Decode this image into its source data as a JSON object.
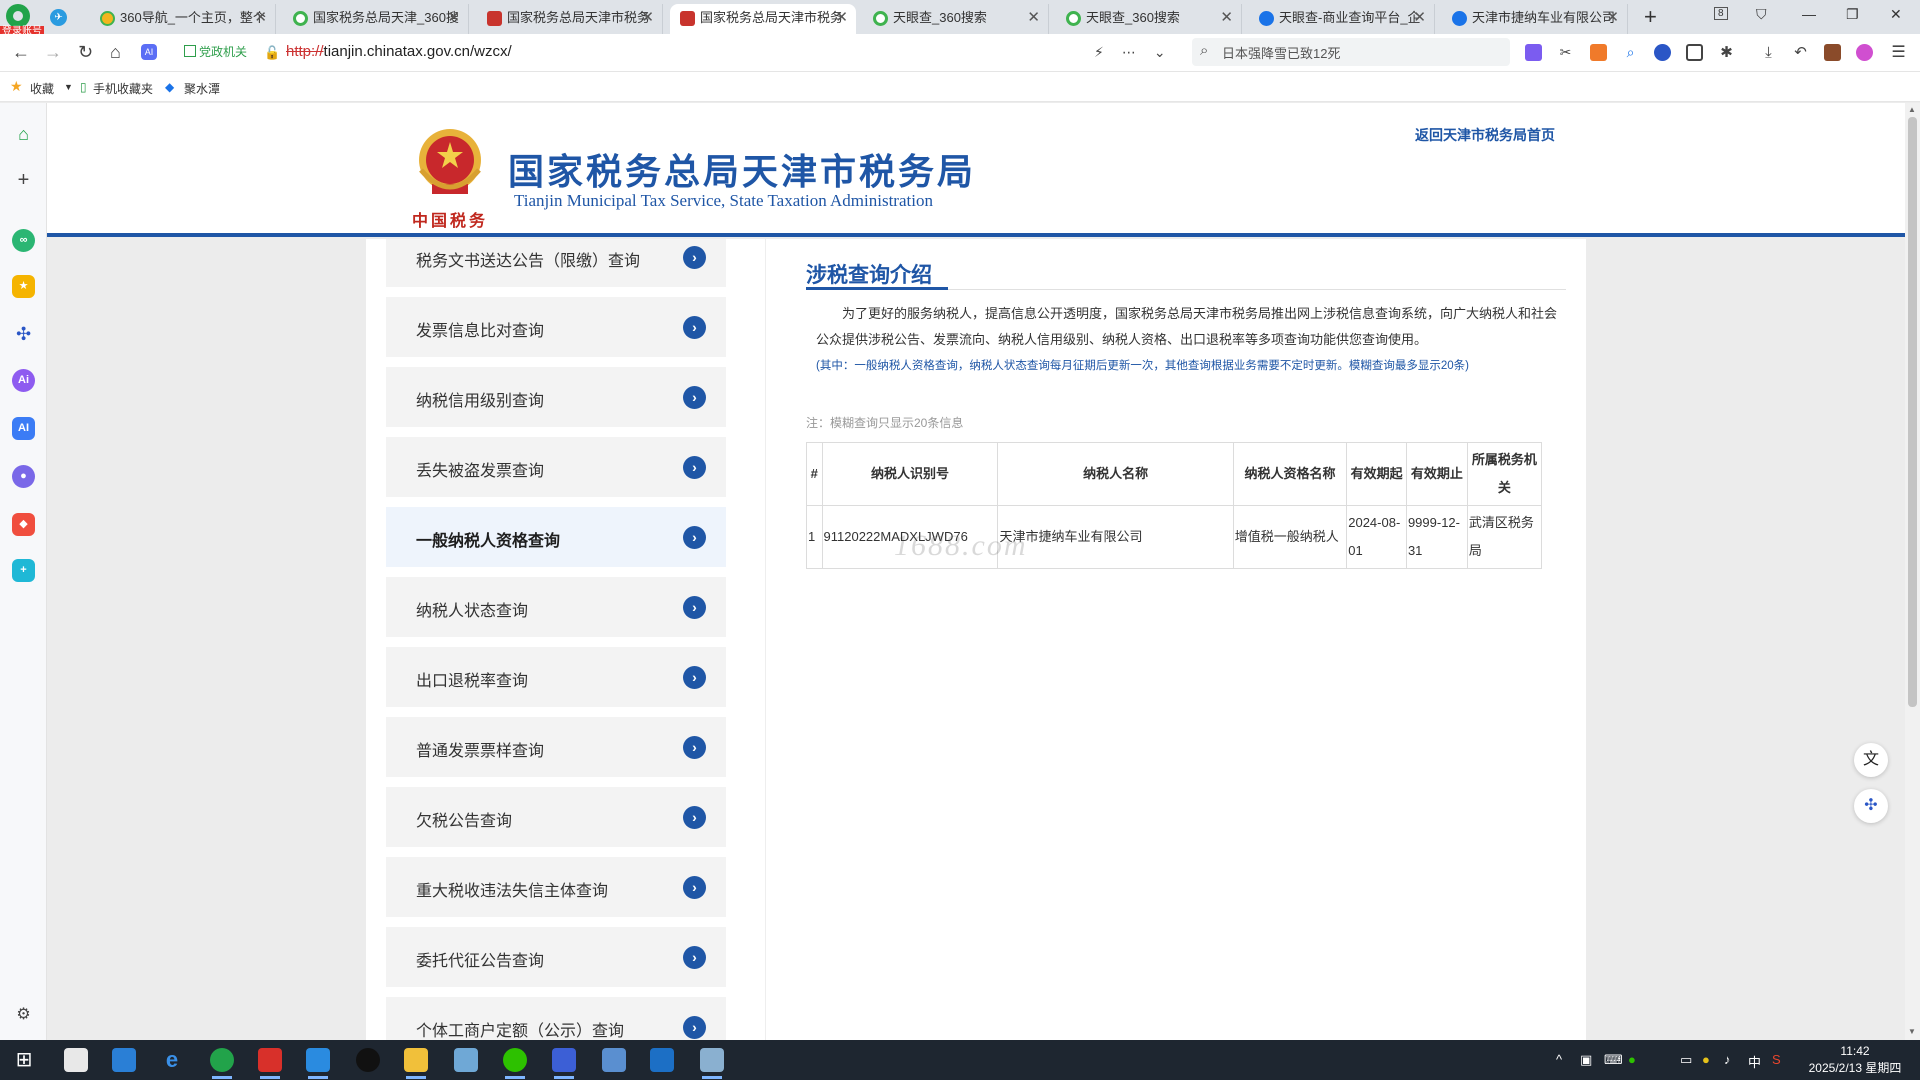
{
  "browser": {
    "login_badge": "登录账号",
    "tabs": [
      {
        "title": "360导航_一个主页，整个",
        "favicon": "360-nav"
      },
      {
        "title": "国家税务总局天津_360搜",
        "favicon": "360-search"
      },
      {
        "title": "国家税务总局天津市税务",
        "favicon": "tax"
      },
      {
        "title": "国家税务总局天津市税务",
        "favicon": "tax",
        "active": true
      },
      {
        "title": "天眼查_360搜索",
        "favicon": "360-search"
      },
      {
        "title": "天眼查_360搜索",
        "favicon": "360-search"
      },
      {
        "title": "天眼查-商业查询平台_企",
        "favicon": "tianyancha"
      },
      {
        "title": "天津市捷纳车业有限公司",
        "favicon": "tianyancha"
      }
    ],
    "tab_count_badge": "8",
    "url_protocol": "http://",
    "url_rest": "tianjin.chinatax.gov.cn/wzcx/",
    "gov_badge": "党政机关",
    "search_text": "日本强降雪已致12死",
    "bookmarks": {
      "favorites": "收藏",
      "mobile": "手机收藏夹",
      "juhe": "聚水潭"
    }
  },
  "site": {
    "title_cn": "国家税务总局天津市税务局",
    "title_en": "Tianjin Municipal Tax Service, State Taxation Administration",
    "emblem_script": "中国税务",
    "home_link": "返回天津市税务局首页"
  },
  "menu": {
    "items": [
      {
        "label": "税务文书送达公告（限缴）查询"
      },
      {
        "label": "发票信息比对查询"
      },
      {
        "label": "纳税信用级别查询"
      },
      {
        "label": "丢失被盗发票查询"
      },
      {
        "label": "一般纳税人资格查询",
        "active": true
      },
      {
        "label": "纳税人状态查询"
      },
      {
        "label": "出口退税率查询"
      },
      {
        "label": "普通发票票样查询"
      },
      {
        "label": "欠税公告查询"
      },
      {
        "label": "重大税收违法失信主体查询"
      },
      {
        "label": "委托代征公告查询"
      },
      {
        "label": "个体工商户定额（公示）查询"
      }
    ]
  },
  "content": {
    "intro_title": "涉税查询介绍",
    "intro_text": "为了更好的服务纳税人，提高信息公开透明度，国家税务总局天津市税务局推出网上涉税信息查询系统，向广大纳税人和社会公众提供涉税公告、发票流向、纳税人信用级别、纳税人资格、出口退税率等多项查询功能供您查询使用。",
    "intro_note": "(其中：一般纳税人资格查询，纳税人状态查询每月征期后更新一次，其他查询根据业务需要不定时更新。模糊查询最多显示20条)",
    "fuzzy_note": "注：模糊查询只显示20条信息",
    "watermark": "1688.com",
    "table": {
      "headers": [
        "#",
        "纳税人识别号",
        "纳税人名称",
        "纳税人资格名称",
        "有效期起",
        "有效期止",
        "所属税务机关"
      ],
      "rows": [
        [
          "1",
          "91120222MADXLJWD76",
          "天津市捷纳车业有限公司",
          "增值税一般纳税人",
          "2024-08-01",
          "9999-12-31",
          "武清区税务局"
        ]
      ]
    }
  },
  "taskbar": {
    "ime": "中",
    "time": "11:42",
    "date": "2025/2/13 星期四"
  }
}
